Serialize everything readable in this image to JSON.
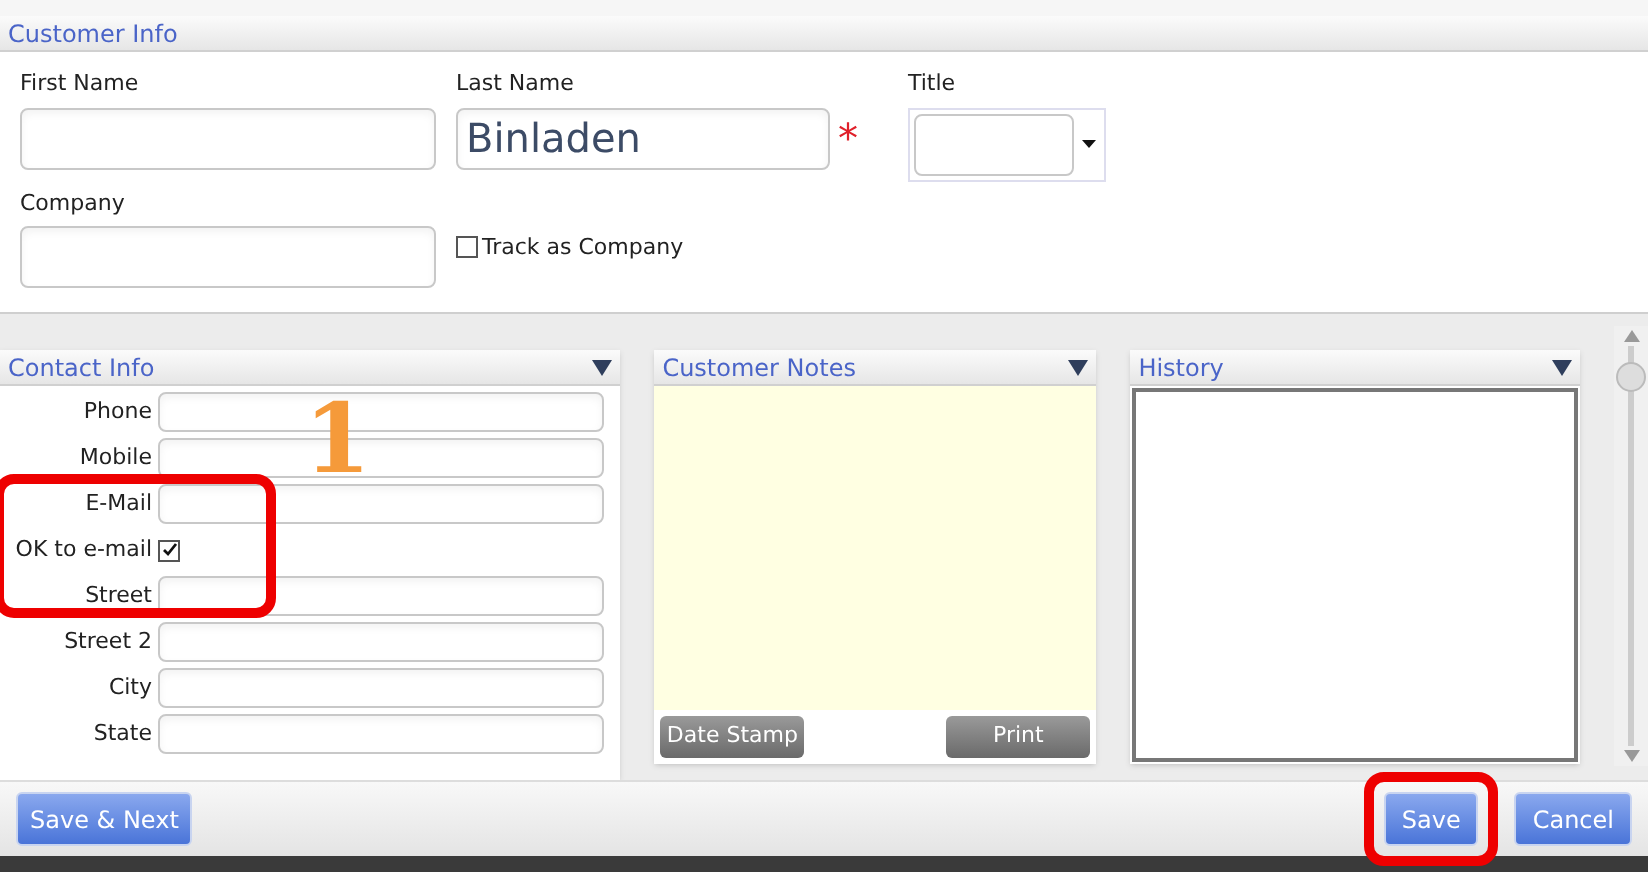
{
  "customer_info": {
    "title": "Customer Info",
    "first_name": {
      "label": "First Name"
    },
    "last_name": {
      "label": "Last Name",
      "value": "Binladen",
      "required_mark": "*"
    },
    "title_field": {
      "label": "Title"
    },
    "company": {
      "label": "Company"
    },
    "track_as_company": {
      "label": "Track as Company",
      "checked": false
    }
  },
  "contact_info": {
    "title": "Contact Info",
    "rows": [
      {
        "kind": "field",
        "label": "Phone"
      },
      {
        "kind": "field",
        "label": "Mobile"
      },
      {
        "kind": "field",
        "label": "E-Mail"
      },
      {
        "kind": "checkbox",
        "label": "OK to e-mail",
        "checked": true
      },
      {
        "kind": "field",
        "label": "Street"
      },
      {
        "kind": "field",
        "label": "Street 2"
      },
      {
        "kind": "field",
        "label": "City"
      },
      {
        "kind": "field",
        "label": "State"
      }
    ]
  },
  "customer_notes": {
    "title": "Customer Notes",
    "buttons": [
      "Date Stamp",
      "Print"
    ]
  },
  "history": {
    "title": "History"
  },
  "footer": {
    "left_buttons": [
      "Save & Next"
    ],
    "right_buttons": [
      "Save",
      "Cancel"
    ]
  },
  "annotation": {
    "step": "1"
  }
}
